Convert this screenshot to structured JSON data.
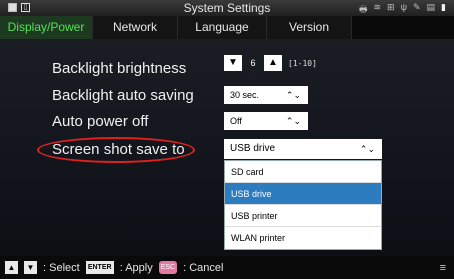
{
  "window": {
    "title": "System Settings"
  },
  "tabs": [
    {
      "label": "Display/Power",
      "active": true
    },
    {
      "label": "Network",
      "active": false
    },
    {
      "label": "Language",
      "active": false
    },
    {
      "label": "Version",
      "active": false
    }
  ],
  "settings": {
    "backlight_brightness": {
      "label": "Backlight brightness",
      "value": "6",
      "range": "[1-10]"
    },
    "backlight_auto_saving": {
      "label": "Backlight auto saving",
      "value": "30 sec."
    },
    "auto_power_off": {
      "label": "Auto power off",
      "value": "Off"
    },
    "screenshot_save_to": {
      "label": "Screen shot save to",
      "value": "USB drive",
      "options": [
        "SD card",
        "USB drive",
        "USB printer",
        "WLAN printer"
      ]
    }
  },
  "footer": {
    "select_label": ": Select",
    "enter_key": "ENTER",
    "apply_label": ": Apply",
    "esc_key": "ESC",
    "cancel_label": ": Cancel"
  },
  "icons": {
    "up": "triangle-up-icon",
    "down": "triangle-down-icon",
    "chevron": "chevron-updown-icon",
    "menu": "menu-icon"
  },
  "colors": {
    "active_tab_text": "#56e05a",
    "selected_option": "#2d7cc0",
    "highlight_circle": "#e02020"
  }
}
